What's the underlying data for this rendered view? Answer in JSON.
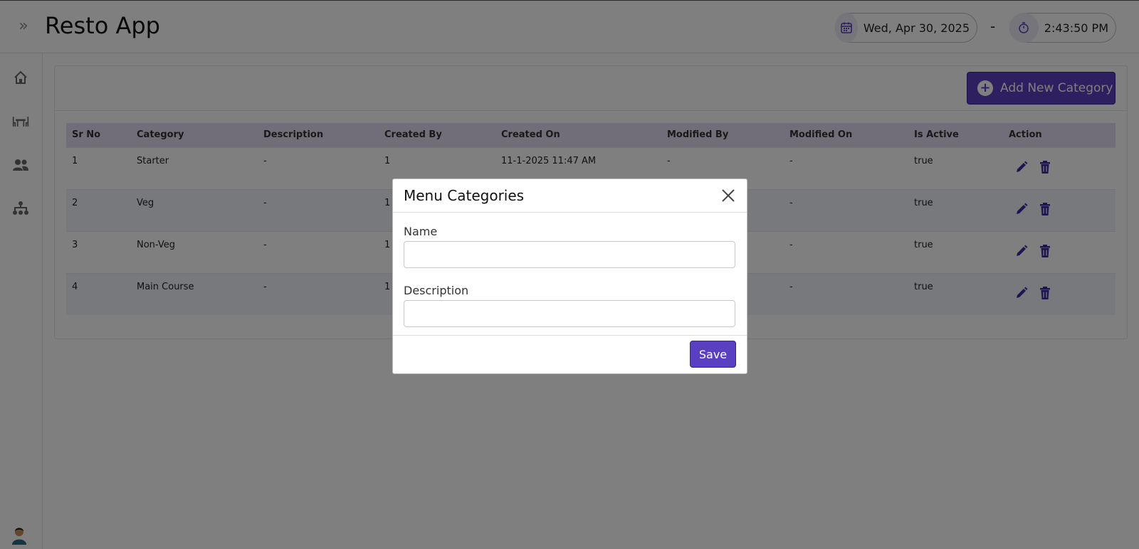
{
  "header": {
    "app_title": "Resto App",
    "date": "Wed, Apr 30, 2025",
    "separator": "-",
    "time": "2:43:50 PM",
    "toggle_glyph": "»"
  },
  "sidebar": {
    "items": [
      {
        "icon": "home-icon"
      },
      {
        "icon": "dining-table-icon"
      },
      {
        "icon": "users-icon"
      },
      {
        "icon": "sitemap-icon"
      }
    ],
    "avatar": "user-avatar-icon"
  },
  "toolbar": {
    "add_label": "Add New Category"
  },
  "table": {
    "headers": [
      "Sr No",
      "Category",
      "Description",
      "Created By",
      "Created On",
      "Modified By",
      "Modified On",
      "Is Active",
      "Action"
    ],
    "rows": [
      [
        "1",
        "Starter",
        "-",
        "1",
        "11-1-2025 11:47 AM",
        "-",
        "-",
        "true"
      ],
      [
        "2",
        "Veg",
        "-",
        "1",
        "",
        "",
        "-",
        "true"
      ],
      [
        "3",
        "Non-Veg",
        "-",
        "1",
        "",
        "",
        "-",
        "true"
      ],
      [
        "4",
        "Main Course",
        "-",
        "1",
        "",
        "",
        "-",
        "true"
      ]
    ]
  },
  "modal": {
    "title": "Menu Categories",
    "name_label": "Name",
    "name_value": "",
    "description_label": "Description",
    "description_value": "",
    "save_label": "Save"
  },
  "colors": {
    "accent": "#5a3fc0",
    "header_row": "#e2ddf4",
    "alt_row": "#eef2fb"
  }
}
